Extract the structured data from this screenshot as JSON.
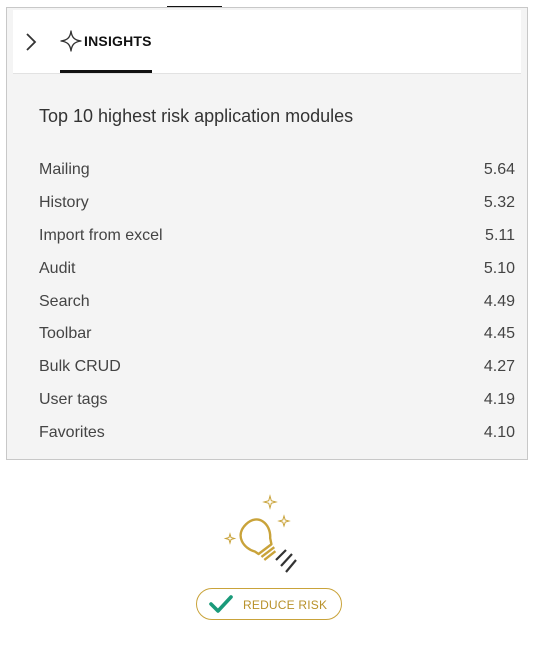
{
  "header": {
    "tab_label": "INSIGHTS"
  },
  "insights": {
    "title": "Top 10 highest risk application modules",
    "modules": [
      {
        "name": "Mailing",
        "score": "5.64"
      },
      {
        "name": "History",
        "score": "5.32"
      },
      {
        "name": "Import from excel",
        "score": "5.11"
      },
      {
        "name": "Audit",
        "score": "5.10"
      },
      {
        "name": "Search",
        "score": "4.49"
      },
      {
        "name": "Toolbar",
        "score": "4.45"
      },
      {
        "name": "Bulk CRUD",
        "score": "4.27"
      },
      {
        "name": "User tags",
        "score": "4.19"
      },
      {
        "name": "Favorites",
        "score": "4.10"
      }
    ]
  },
  "action": {
    "label": "REDUCE RISK"
  },
  "colors": {
    "accent_gold": "#c9a33a",
    "check_green": "#1a9a7a",
    "panel_bg": "#f4f4f4"
  },
  "icons": {
    "collapse": "chevron-right-icon",
    "tab": "sparkle-icon",
    "illustration": "lightbulb-icon",
    "button": "checkmark-icon"
  }
}
